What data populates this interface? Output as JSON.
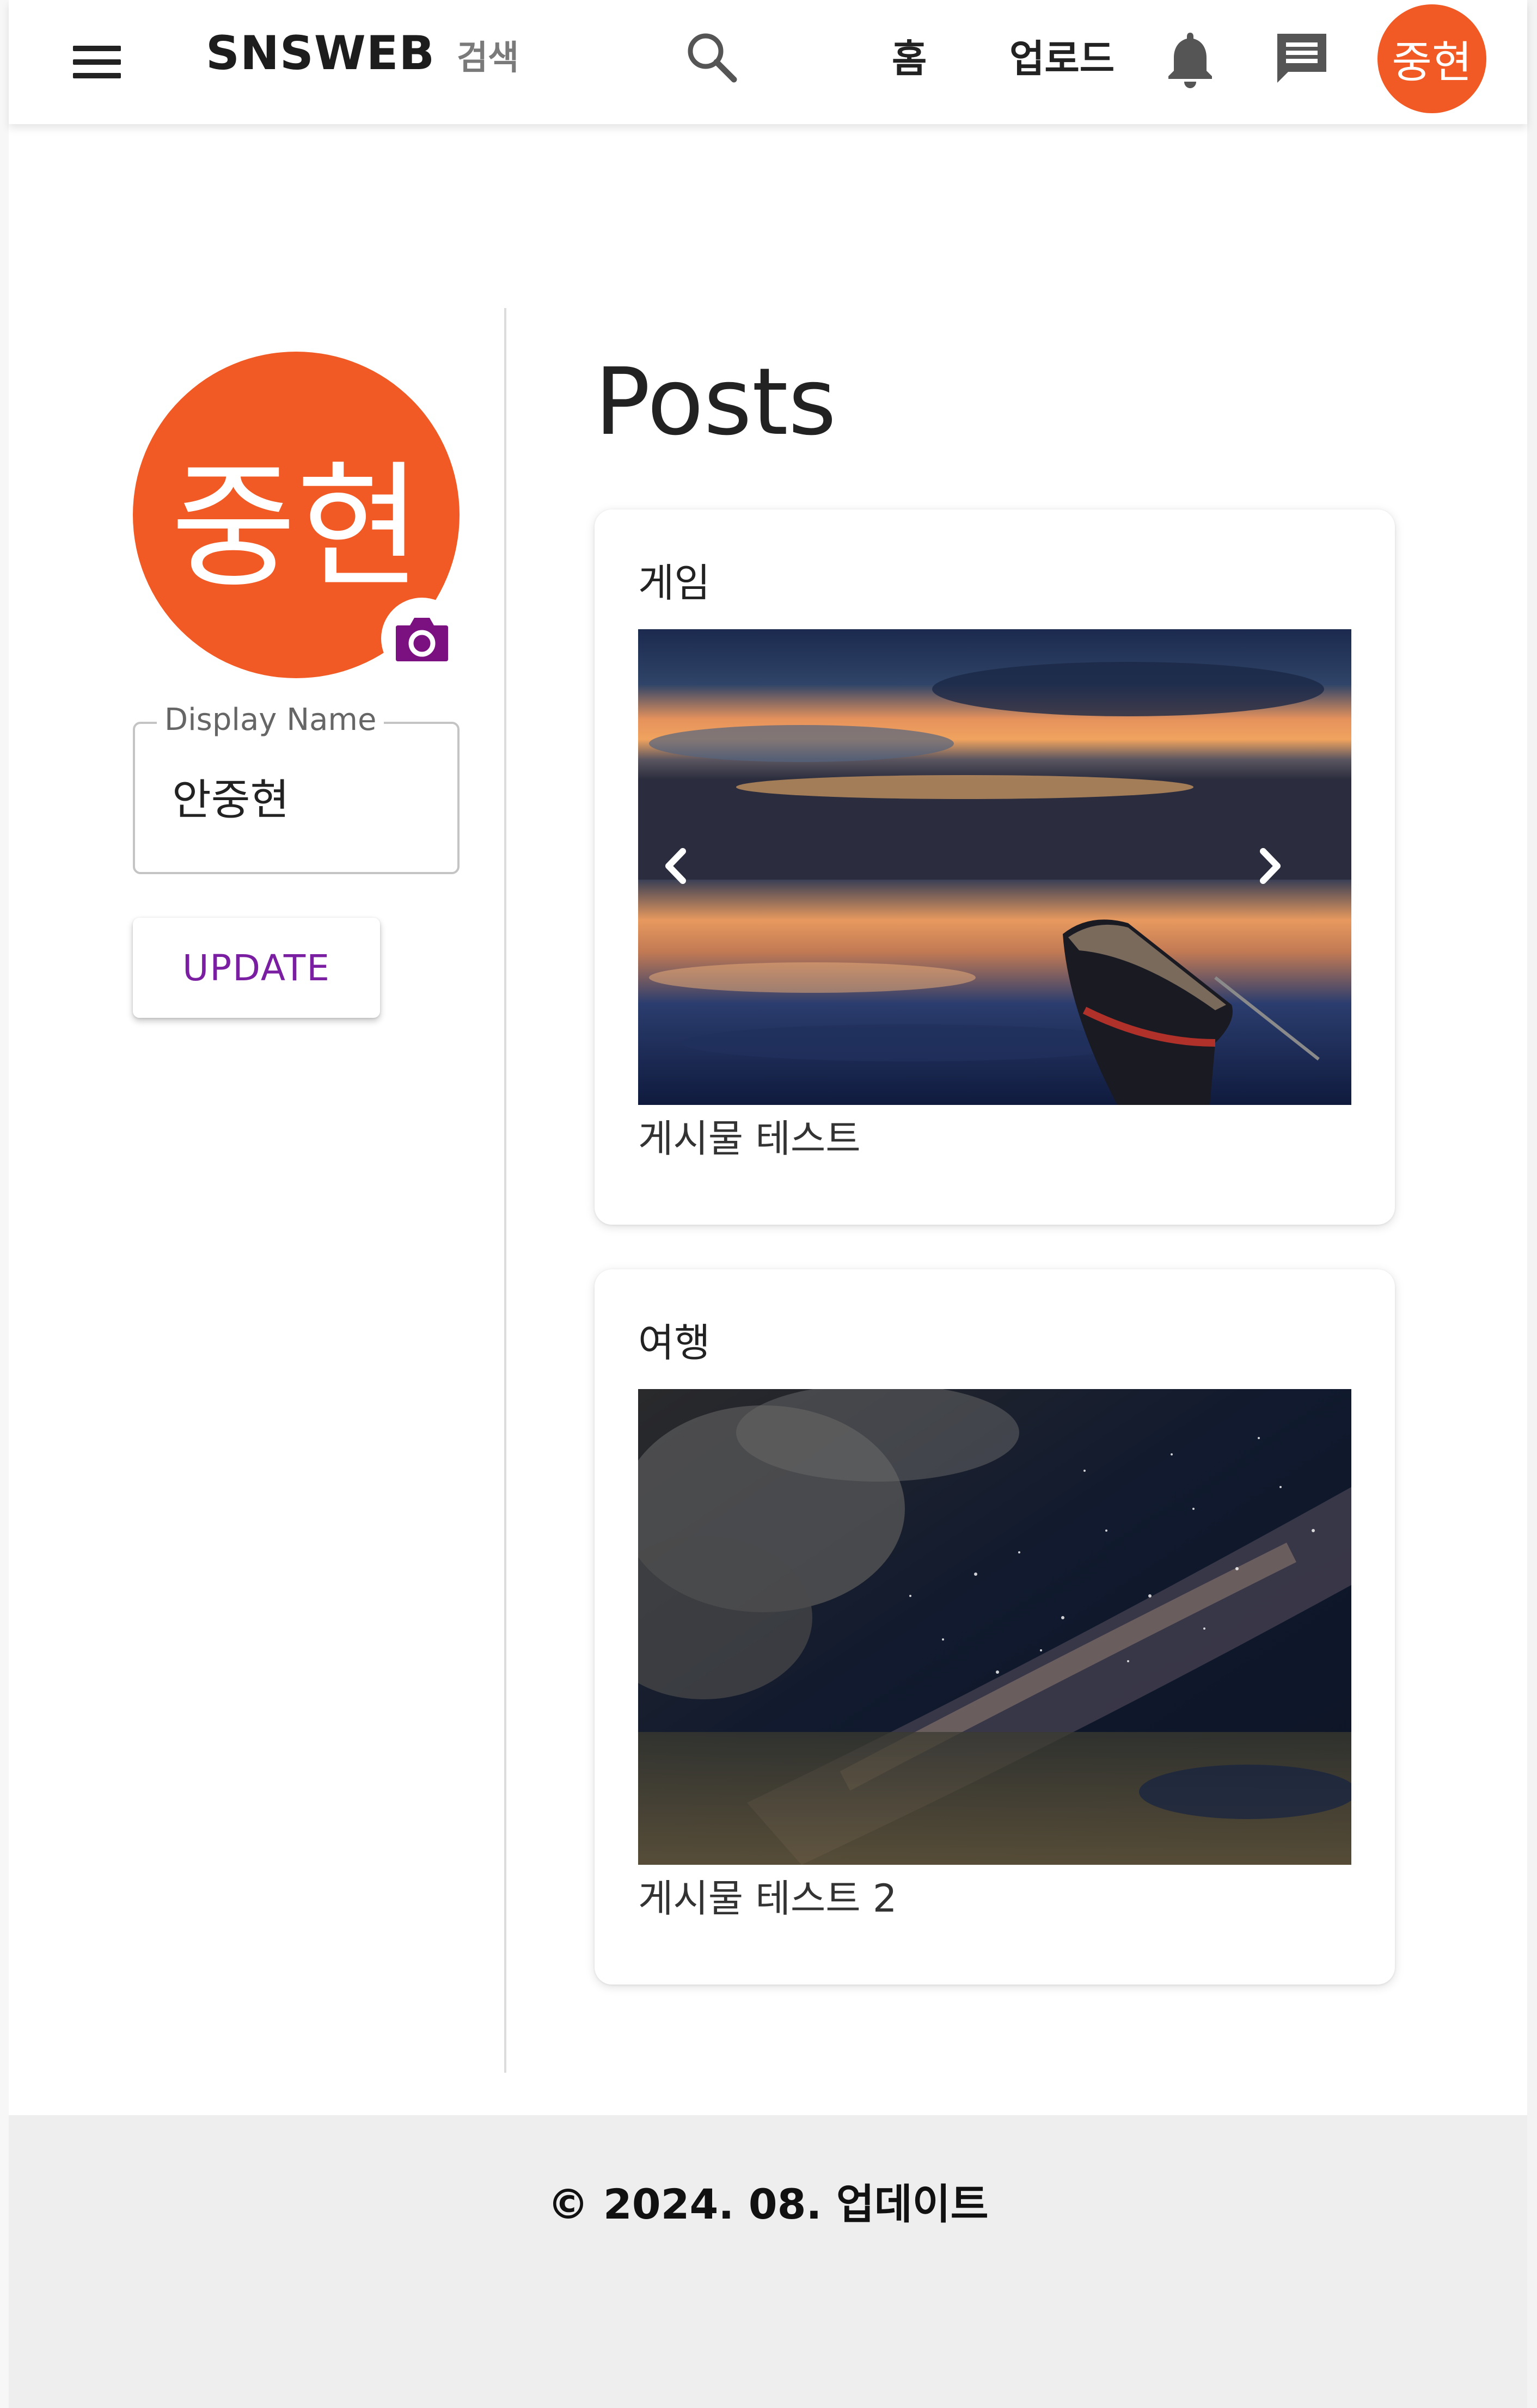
{
  "header": {
    "brand": "SNSWEB",
    "search_label": "검색",
    "nav_home": "홈",
    "nav_upload": "업로드",
    "avatar_initials": "중현",
    "avatar_color": "#f15a24"
  },
  "icons": {
    "menu": "hamburger-menu-icon",
    "search": "search-icon",
    "notifications": "bell-icon",
    "messages": "chat-icon",
    "photo": "camera-icon",
    "carousel_prev": "chevron-left-icon",
    "carousel_next": "chevron-right-icon"
  },
  "profile": {
    "avatar_initials": "중현",
    "display_name_label": "Display Name",
    "display_name_value": "안중현",
    "update_button": "UPDATE",
    "accent_color": "#7b1fa2"
  },
  "posts": {
    "title": "Posts",
    "items": [
      {
        "category": "게임",
        "caption": "게시물 테스트"
      },
      {
        "category": "여행",
        "caption": "게시물 테스트 2"
      }
    ]
  },
  "footer": {
    "text": "© 2024. 08. 업데이트"
  }
}
